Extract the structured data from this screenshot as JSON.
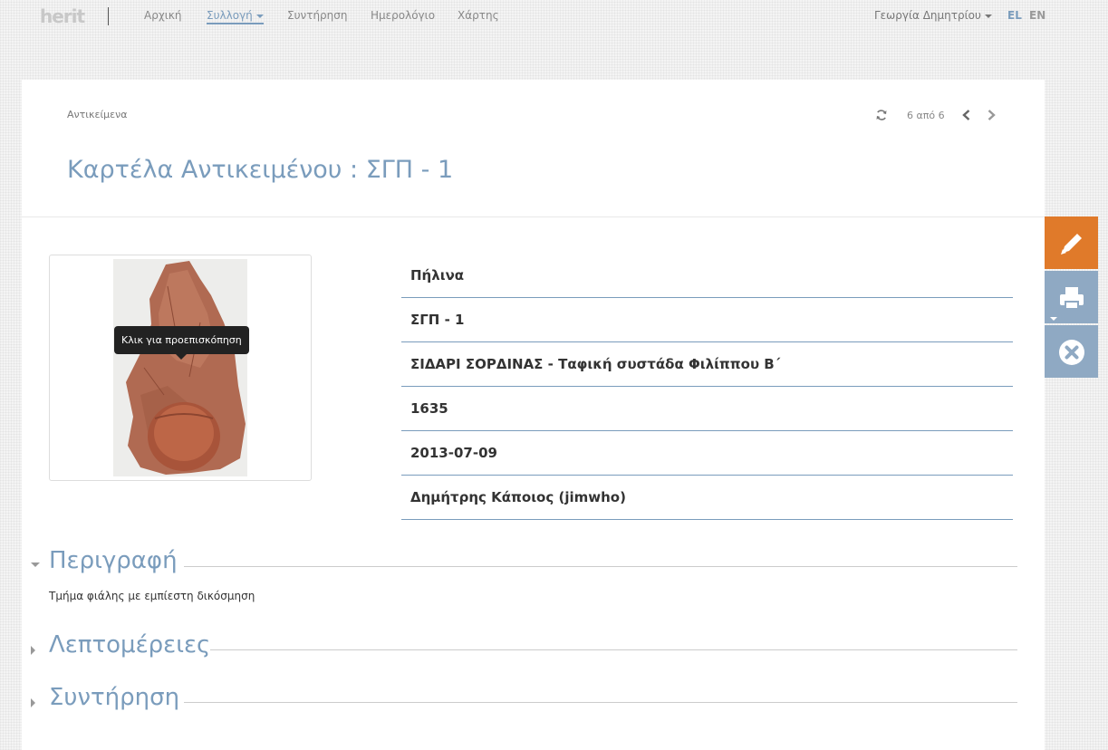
{
  "brand": {
    "logo_text": "herit"
  },
  "nav": {
    "items": [
      {
        "label": "Αρχική"
      },
      {
        "label": "Συλλογή"
      },
      {
        "label": "Συντήρηση"
      },
      {
        "label": "Ημερολόγιο"
      },
      {
        "label": "Χάρτης"
      }
    ],
    "active_index": 1,
    "user_name": "Γεωργία Δημητρίου",
    "languages": [
      {
        "label": "EL",
        "active": true
      },
      {
        "label": "EN",
        "active": false
      }
    ]
  },
  "card": {
    "breadcrumb": "Αντικείμενα",
    "pager": {
      "count_text": "6 από 6",
      "refresh_icon": "refresh-icon",
      "prev_icon": "chevron-left-icon",
      "next_icon": "chevron-right-icon"
    },
    "title": "Καρτέλα Αντικειμένου : ΣΓΠ - 1"
  },
  "thumbnail": {
    "tooltip": "Κλικ για προεπισκόπηση"
  },
  "fields": [
    {
      "value": "Πήλινα"
    },
    {
      "value": "ΣΓΠ - 1"
    },
    {
      "value": "ΣΙΔΑΡΙ ΣΟΡΔΙΝΑΣ - Ταφική συστάδα Φιλίππου Β΄"
    },
    {
      "value": "1635"
    },
    {
      "value": "2013-07-09"
    },
    {
      "value": "Δημήτρης Κάποιος (jimwho)"
    }
  ],
  "sections": [
    {
      "title": "Περιγραφή",
      "expanded": true,
      "body": "Τμήμα φιάλης με εμπίεστη δικόσμηση"
    },
    {
      "title": "Λεπτομέρειες",
      "expanded": false
    },
    {
      "title": "Συντήρηση",
      "expanded": false
    }
  ],
  "side_actions": [
    {
      "icon": "pencil-icon",
      "color": "#e07a2a"
    },
    {
      "icon": "print-icon",
      "color": "#8fa9c3"
    },
    {
      "icon": "close-circle-icon",
      "color": "#8fa9c3"
    }
  ],
  "colors": {
    "accent": "#7a9cbc",
    "edit": "#e07a2a",
    "side_button": "#8fa9c3"
  }
}
